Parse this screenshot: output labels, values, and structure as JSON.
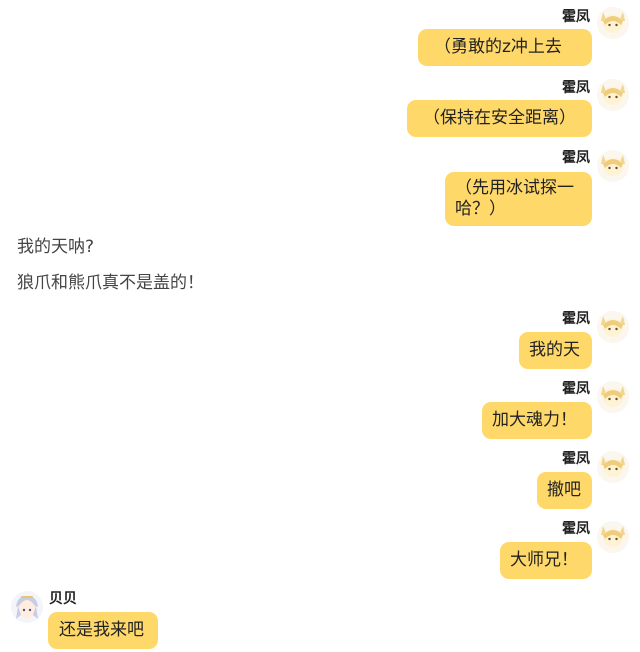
{
  "chat": {
    "speakers": {
      "huofeng": "霍凤",
      "beibei": "贝贝"
    },
    "messages": [
      {
        "speaker": "霍凤",
        "text": "（勇敢的z冲上去"
      },
      {
        "speaker": "霍凤",
        "text": "（保持在安全距离）"
      },
      {
        "speaker": "霍凤",
        "text": "（先用冰试探一\n哈？）"
      },
      {
        "speaker": "霍凤",
        "text": "我的天"
      },
      {
        "speaker": "霍凤",
        "text": "加大魂力！"
      },
      {
        "speaker": "霍凤",
        "text": "撤吧"
      },
      {
        "speaker": "霍凤",
        "text": "大师兄！"
      },
      {
        "speaker": "贝贝",
        "text": "还是我来吧"
      }
    ],
    "narration": [
      "我的天呐?",
      "狼爪和熊爪真不是盖的！"
    ]
  },
  "icons": {
    "huofeng_avatar": "fox-girl-avatar-icon",
    "beibei_avatar": "silver-hair-avatar-icon"
  },
  "colors": {
    "bubble": "#ffd86a",
    "background": "#ffffff"
  }
}
